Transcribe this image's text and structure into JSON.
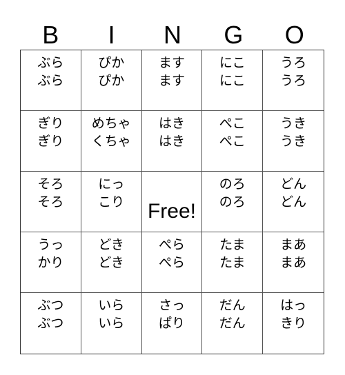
{
  "header": {
    "letters": [
      "B",
      "I",
      "N",
      "G",
      "O"
    ]
  },
  "grid": {
    "rows": [
      [
        {
          "line1": "ぶら",
          "line2": "ぶら"
        },
        {
          "line1": "ぴか",
          "line2": "ぴか"
        },
        {
          "line1": "ます",
          "line2": "ます"
        },
        {
          "line1": "にこ",
          "line2": "にこ"
        },
        {
          "line1": "うろ",
          "line2": "うろ"
        }
      ],
      [
        {
          "line1": "ぎり",
          "line2": "ぎり"
        },
        {
          "line1": "めちゃ",
          "line2": "くちゃ"
        },
        {
          "line1": "はき",
          "line2": "はき"
        },
        {
          "line1": "ぺこ",
          "line2": "ぺこ"
        },
        {
          "line1": "うき",
          "line2": "うき"
        }
      ],
      [
        {
          "line1": "そろ",
          "line2": "そろ"
        },
        {
          "line1": "にっ",
          "line2": "こり"
        },
        {
          "free": "Free!"
        },
        {
          "line1": "のろ",
          "line2": "のろ"
        },
        {
          "line1": "どん",
          "line2": "どん"
        }
      ],
      [
        {
          "line1": "うっ",
          "line2": "かり"
        },
        {
          "line1": "どき",
          "line2": "どき"
        },
        {
          "line1": "ぺら",
          "line2": "ぺら"
        },
        {
          "line1": "たま",
          "line2": "たま"
        },
        {
          "line1": "まあ",
          "line2": "まあ"
        }
      ],
      [
        {
          "line1": "ぶつ",
          "line2": "ぶつ"
        },
        {
          "line1": "いら",
          "line2": "いら"
        },
        {
          "line1": "さっ",
          "line2": "ぱり"
        },
        {
          "line1": "だん",
          "line2": "だん"
        },
        {
          "line1": "はっ",
          "line2": "きり"
        }
      ]
    ]
  }
}
